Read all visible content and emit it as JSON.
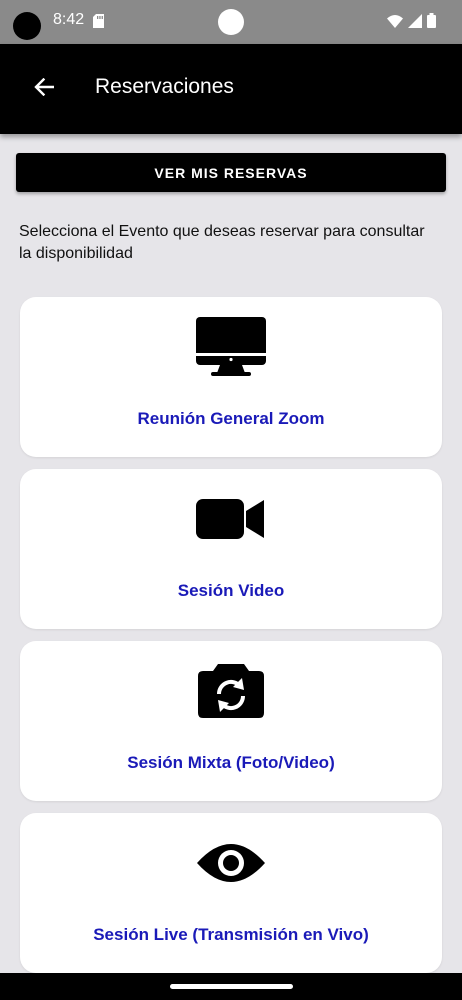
{
  "status_bar": {
    "time": "8:42",
    "icons": [
      "sd-card-icon",
      "wifi-icon",
      "signal-icon",
      "battery-icon"
    ]
  },
  "app_bar": {
    "title": "Reservaciones",
    "back_icon": "arrow-left-icon"
  },
  "main": {
    "ver_reservas_label": "VER MIS RESERVAS",
    "instructions": "Selecciona el Evento que deseas reservar para consultar la disponibilidad",
    "events": [
      {
        "label": "Reunión General Zoom",
        "icon": "monitor-icon"
      },
      {
        "label": "Sesión Video",
        "icon": "video-camera-icon"
      },
      {
        "label": "Sesión Mixta (Foto/Video)",
        "icon": "camera-switch-icon"
      },
      {
        "label": "Sesión Live (Transmisión en Vivo)",
        "icon": "eye-icon"
      }
    ]
  },
  "colors": {
    "background": "#e6e5e9",
    "app_bar": "#000000",
    "accent_text": "#1a1ab8",
    "card": "#ffffff"
  }
}
